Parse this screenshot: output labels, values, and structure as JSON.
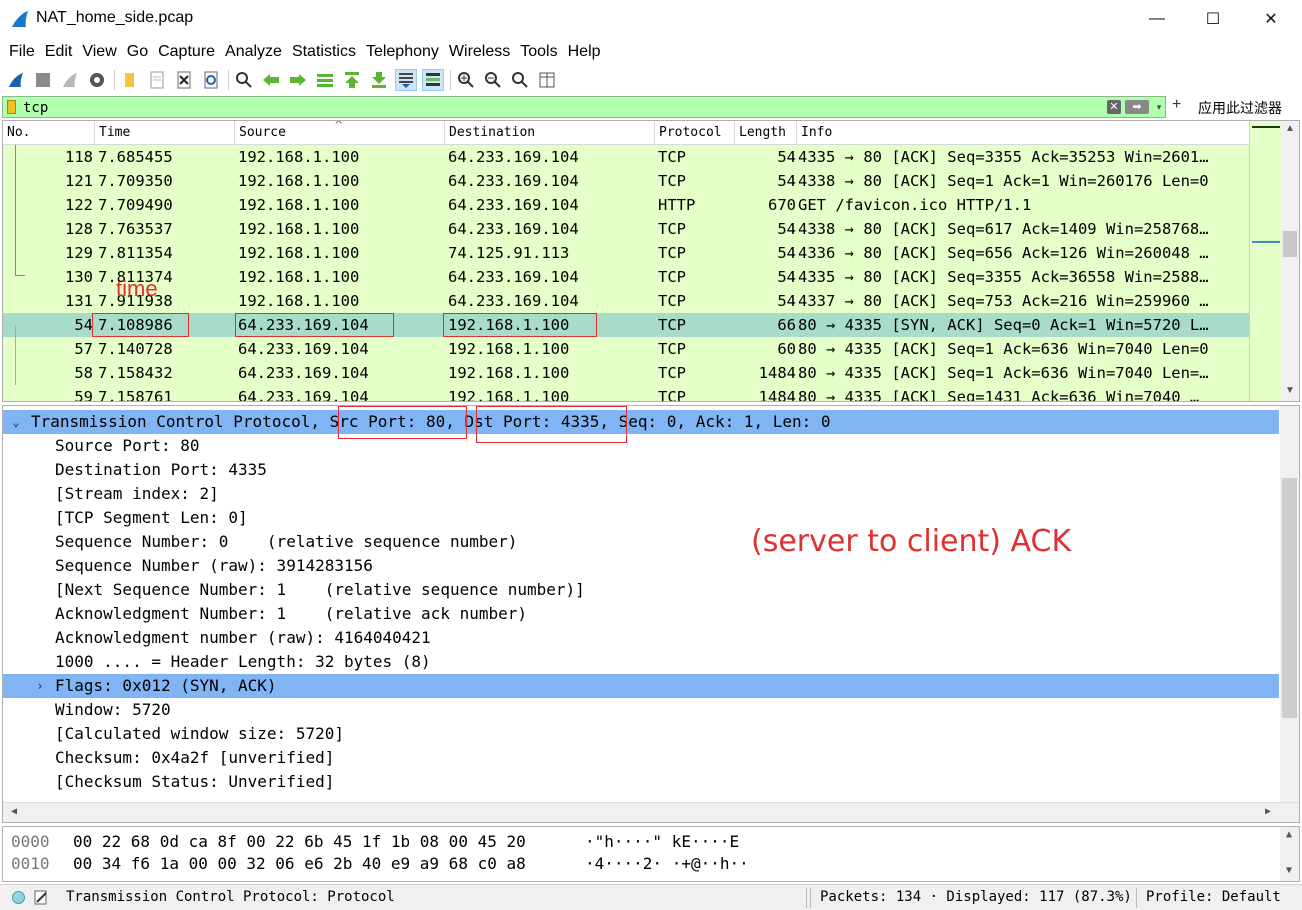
{
  "window": {
    "title": "NAT_home_side.pcap",
    "min_glyph": "—",
    "max_glyph": "☐",
    "close_glyph": "✕"
  },
  "menu": [
    "File",
    "Edit",
    "View",
    "Go",
    "Capture",
    "Analyze",
    "Statistics",
    "Telephony",
    "Wireless",
    "Tools",
    "Help"
  ],
  "toolbar": {
    "icons": [
      "shark-fin-start-icon",
      "stop-square-icon",
      "restart-fin-icon",
      "capture-options-gear-icon",
      "open-folder-icon",
      "file-icon",
      "close-file-icon",
      "reload-icon",
      "find-packet-icon",
      "go-back-icon",
      "go-forward-icon",
      "go-to-packet-icon",
      "go-first-icon",
      "go-last-icon",
      "autoscroll-icon",
      "colorize-icon",
      "zoom-in-icon",
      "zoom-out-icon",
      "zoom-normal-icon",
      "resize-columns-icon"
    ]
  },
  "filter": {
    "value": "tcp",
    "clear_glyph": "✕",
    "apply_glyph": "➡",
    "drop_glyph": "▾",
    "plus_glyph": "+",
    "apply_label": "应用此过滤器"
  },
  "packet_list": {
    "columns": [
      "No.",
      "Time",
      "Source",
      "Destination",
      "Protocol",
      "Length",
      "Info"
    ],
    "sort_indicator": "^",
    "rows": [
      {
        "no": "118",
        "time": "7.685455",
        "src": "192.168.1.100",
        "dst": "64.233.169.104",
        "proto": "TCP",
        "len": "54",
        "info": "4335 → 80 [ACK] Seq=3355 Ack=35253 Win=2601…"
      },
      {
        "no": "121",
        "time": "7.709350",
        "src": "192.168.1.100",
        "dst": "64.233.169.104",
        "proto": "TCP",
        "len": "54",
        "info": "4338 → 80 [ACK] Seq=1 Ack=1 Win=260176 Len=0"
      },
      {
        "no": "122",
        "time": "7.709490",
        "src": "192.168.1.100",
        "dst": "64.233.169.104",
        "proto": "HTTP",
        "len": "670",
        "info": "GET /favicon.ico HTTP/1.1"
      },
      {
        "no": "128",
        "time": "7.763537",
        "src": "192.168.1.100",
        "dst": "64.233.169.104",
        "proto": "TCP",
        "len": "54",
        "info": "4338 → 80 [ACK] Seq=617 Ack=1409 Win=258768…"
      },
      {
        "no": "129",
        "time": "7.811354",
        "src": "192.168.1.100",
        "dst": "74.125.91.113",
        "proto": "TCP",
        "len": "54",
        "info": "4336 → 80 [ACK] Seq=656 Ack=126 Win=260048 …"
      },
      {
        "no": "130",
        "time": "7.811374",
        "src": "192.168.1.100",
        "dst": "64.233.169.104",
        "proto": "TCP",
        "len": "54",
        "info": "4335 → 80 [ACK] Seq=3355 Ack=36558 Win=2588…"
      },
      {
        "no": "131",
        "time": "7.911938",
        "src": "192.168.1.100",
        "dst": "64.233.169.104",
        "proto": "TCP",
        "len": "54",
        "info": "4337 → 80 [ACK] Seq=753 Ack=216 Win=259960 …"
      },
      {
        "no": "54",
        "time": "7.108986",
        "src": "64.233.169.104",
        "dst": "192.168.1.100",
        "proto": "TCP",
        "len": "66",
        "info": "80 → 4335 [SYN, ACK] Seq=0 Ack=1 Win=5720 L…",
        "selected": true
      },
      {
        "no": "57",
        "time": "7.140728",
        "src": "64.233.169.104",
        "dst": "192.168.1.100",
        "proto": "TCP",
        "len": "60",
        "info": "80 → 4335 [ACK] Seq=1 Ack=636 Win=7040 Len=0"
      },
      {
        "no": "58",
        "time": "7.158432",
        "src": "64.233.169.104",
        "dst": "192.168.1.100",
        "proto": "TCP",
        "len": "1484",
        "info": "80 → 4335 [ACK] Seq=1 Ack=636 Win=7040 Len=…"
      },
      {
        "no": "59",
        "time": "7.158761",
        "src": "64.233.169.104",
        "dst": "192.168.1.100",
        "proto": "TCP",
        "len": "1484",
        "info": "80 → 4335 [ACK] Seq=1431 Ack=636 Win=7040 …"
      }
    ]
  },
  "annotations": {
    "time_label": "time",
    "note": "(server to client) ACK"
  },
  "details": {
    "header": {
      "arrow": "⌄",
      "prefix": "Transmission Control Protocol, ",
      "src_port": "Src Port: 80",
      "comma1": ",",
      "gap": " ",
      "dst_port": "Dst Port: 4335",
      "suffix": ", Seq: 0, Ack: 1, Len: 0"
    },
    "lines": [
      "Source Port: 80",
      "Destination Port: 4335",
      "[Stream index: 2]",
      "[TCP Segment Len: 0]",
      "Sequence Number: 0    (relative sequence number)",
      "Sequence Number (raw): 3914283156",
      "[Next Sequence Number: 1    (relative sequence number)]",
      "Acknowledgment Number: 1    (relative ack number)",
      "Acknowledgment number (raw): 4164040421",
      "1000 .... = Header Length: 32 bytes (8)"
    ],
    "flags": {
      "arrow": "›",
      "text": "Flags: 0x012 (SYN, ACK)"
    },
    "lines_after": [
      "Window: 5720",
      "[Calculated window size: 5720]",
      "Checksum: 0x4a2f [unverified]",
      "[Checksum Status: Unverified]"
    ]
  },
  "hex": {
    "rows": [
      {
        "offset": "0000",
        "bytes": "00 22 68 0d ca 8f 00 22  6b 45 1f 1b 08 00 45 20",
        "ascii": "·\"h····\" kE····E "
      },
      {
        "offset": "0010",
        "bytes": "00 34 f6 1a 00 00 32 06  e6 2b 40 e9 a9 68 c0 a8",
        "ascii": "·4····2· ·+@··h··"
      }
    ]
  },
  "status": {
    "text": "Transmission Control Protocol: Protocol",
    "packets": "Packets: 134 · Displayed: 117 (87.3%)",
    "profile": "Profile: Default"
  },
  "colors": {
    "tcp_row": "#e4ffc7",
    "selected_row": "#a8dcc9",
    "highlight": "#80b4f5",
    "filter_ok": "#afffaf",
    "annotation": "#e03030"
  }
}
